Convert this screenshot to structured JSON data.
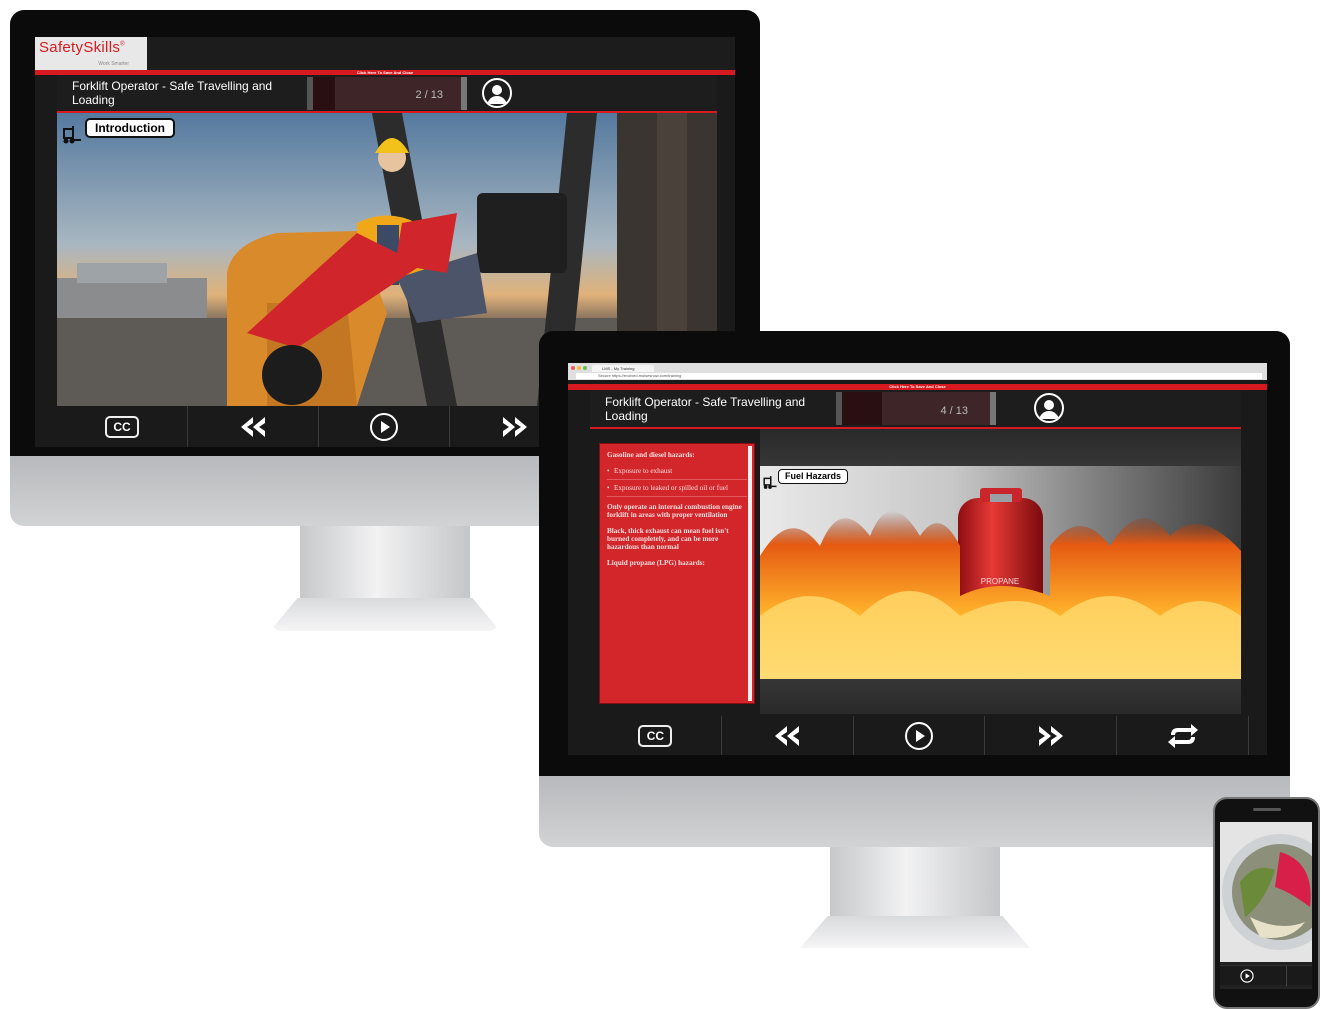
{
  "monitor1": {
    "brand": {
      "name": "SafetySkills",
      "trademark": "®",
      "tagline": "Work Smarter"
    },
    "save_bar": "Click Here To Save And Close",
    "course_title": "Forklift Operator - Safe Travelling and Loading",
    "progress": {
      "current": 2,
      "total": 13,
      "label": "2 / 13"
    },
    "section_tag": "Introduction",
    "controls": [
      "CC",
      "rewind",
      "play",
      "forward"
    ]
  },
  "monitor2": {
    "browser": {
      "tab_title": "LMS - My Training",
      "url": "Secure  https://evolved.molsesnow.com/training"
    },
    "save_bar": "Click Here To Save And Close",
    "course_title": "Forklift Operator - Safe Travelling and Loading",
    "progress": {
      "current": 4,
      "total": 13,
      "label": "4 / 13"
    },
    "sidebar": {
      "heading": "Gasoline and diesel hazards:",
      "bullets": [
        "Exposure to exhaust",
        "Exposure to leaked or spilled oil or fuel"
      ],
      "paragraphs": [
        "Only operate an internal combustion engine forklift in areas with proper ventilation",
        "Black, thick exhaust can mean fuel isn't burned completely, and can be more hazardous than normal",
        "Liquid propane (LPG) hazards:"
      ]
    },
    "section_tag": "Fuel Hazards",
    "tank_label": "PROPANE",
    "controls": [
      "CC",
      "rewind",
      "play",
      "forward",
      "replay"
    ]
  },
  "colors": {
    "brand_red": "#d71920",
    "sidebar_red": "#d3262b",
    "bar_dark": "#1a1a1a"
  }
}
